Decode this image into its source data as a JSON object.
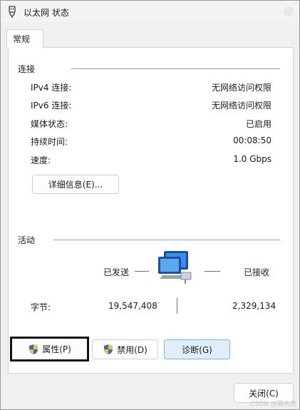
{
  "window": {
    "title": "以太网 状态",
    "tab": "常规"
  },
  "connection": {
    "section_label": "连接",
    "rows": [
      {
        "label": "IPv4 连接:",
        "value": "无网络访问权限"
      },
      {
        "label": "IPv6 连接:",
        "value": "无网络访问权限"
      },
      {
        "label": "媒体状态:",
        "value": "已启用"
      },
      {
        "label": "持续时间:",
        "value": "00:08:50"
      },
      {
        "label": "速度:",
        "value": "1.0 Gbps"
      }
    ],
    "details_button": "详细信息(E)..."
  },
  "activity": {
    "section_label": "活动",
    "sent_label": "已发送",
    "received_label": "已接收",
    "bytes_label": "字节:",
    "bytes_sent": "19,547,408",
    "bytes_received": "2,329,134"
  },
  "buttons": {
    "properties": "属性(P)",
    "disable": "禁用(D)",
    "diagnose": "诊断(G)",
    "close": "关闭(C)"
  },
  "watermark": "CSDN @猫头虎",
  "icons": {
    "title": "ethernet-plug-icon",
    "network": "network-computers-icon",
    "uac": "uac-shield-icon"
  }
}
